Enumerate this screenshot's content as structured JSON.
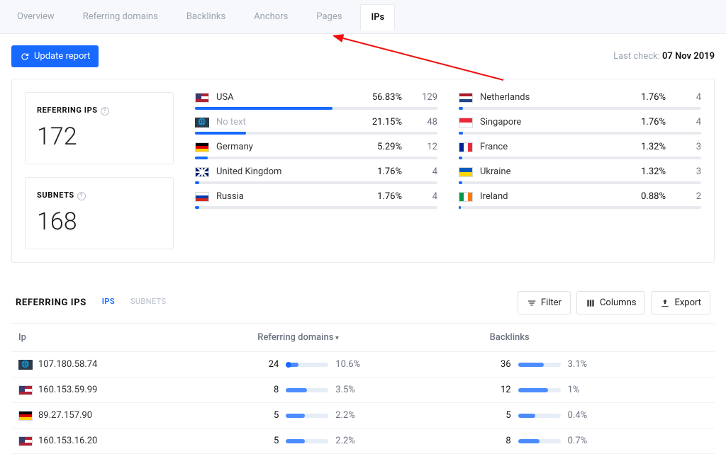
{
  "tabs": {
    "items": [
      "Overview",
      "Referring domains",
      "Backlinks",
      "Anchors",
      "Pages",
      "IPs"
    ],
    "active_index": 5
  },
  "header": {
    "update_button": "Update report",
    "last_check_label": "Last check: ",
    "last_check_date": "07 Nov 2019"
  },
  "stats": {
    "referring_ips_label": "REFERRING IPS",
    "referring_ips_value": "172",
    "subnets_label": "SUBNETS",
    "subnets_value": "168"
  },
  "countries_left": [
    {
      "flag": "usa",
      "name": "USA",
      "percent": "56.83%",
      "count": "129",
      "bar": 56.83
    },
    {
      "flag": "globe",
      "name": "No text",
      "percent": "21.15%",
      "count": "48",
      "bar": 21.15,
      "muted": true
    },
    {
      "flag": "de",
      "name": "Germany",
      "percent": "5.29%",
      "count": "12",
      "bar": 5.29
    },
    {
      "flag": "uk",
      "name": "United Kingdom",
      "percent": "1.76%",
      "count": "4",
      "bar": 1.76
    },
    {
      "flag": "ru",
      "name": "Russia",
      "percent": "1.76%",
      "count": "4",
      "bar": 1.76
    }
  ],
  "countries_right": [
    {
      "flag": "nl",
      "name": "Netherlands",
      "percent": "1.76%",
      "count": "4",
      "bar": 1.76
    },
    {
      "flag": "sg",
      "name": "Singapore",
      "percent": "1.76%",
      "count": "4",
      "bar": 1.76
    },
    {
      "flag": "fr",
      "name": "France",
      "percent": "1.32%",
      "count": "3",
      "bar": 1.32
    },
    {
      "flag": "ua",
      "name": "Ukraine",
      "percent": "1.32%",
      "count": "3",
      "bar": 1.32
    },
    {
      "flag": "ie",
      "name": "Ireland",
      "percent": "0.88%",
      "count": "2",
      "bar": 0.88
    }
  ],
  "table": {
    "title": "REFERRING IPS",
    "subtabs": {
      "ips": "IPS",
      "subnets": "SUBNETS"
    },
    "buttons": {
      "filter": "Filter",
      "columns": "Columns",
      "export": "Export"
    },
    "headers": {
      "ip": "Ip",
      "ref": "Referring domains",
      "bl": "Backlinks"
    },
    "rows": [
      {
        "flag": "globe",
        "ip": "107.180.58.74",
        "ref": "24",
        "ref_pct": "10.6%",
        "ref_bar": 30,
        "bl": "36",
        "bl_pct": "3.1%",
        "bl_bar": 60,
        "dot": true
      },
      {
        "flag": "usa",
        "ip": "160.153.59.99",
        "ref": "8",
        "ref_pct": "3.5%",
        "ref_bar": 50,
        "bl": "12",
        "bl_pct": "1%",
        "bl_bar": 70
      },
      {
        "flag": "de",
        "ip": "89.27.157.90",
        "ref": "5",
        "ref_pct": "2.2%",
        "ref_bar": 45,
        "bl": "5",
        "bl_pct": "0.4%",
        "bl_bar": 40
      },
      {
        "flag": "usa",
        "ip": "160.153.16.20",
        "ref": "5",
        "ref_pct": "2.2%",
        "ref_bar": 45,
        "bl": "8",
        "bl_pct": "0.7%",
        "bl_bar": 50
      }
    ]
  }
}
